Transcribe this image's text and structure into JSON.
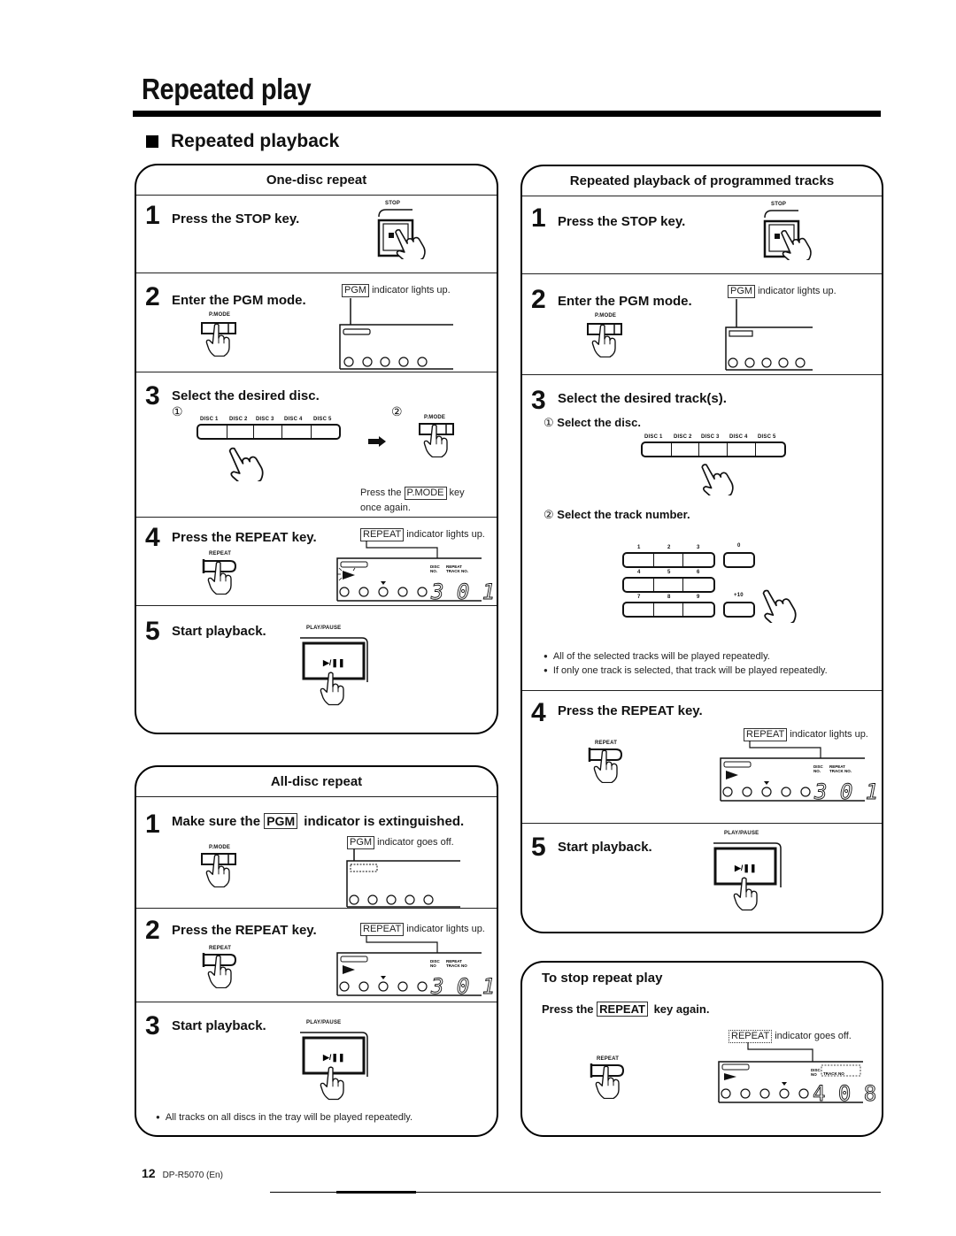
{
  "page": {
    "title": "Repeated play",
    "section": "Repeated playback",
    "footer": {
      "page_number": "12",
      "model": "DP-R5070 (En)"
    }
  },
  "one_disc": {
    "heading": "One-disc repeat",
    "steps": [
      {
        "num": "1",
        "text": "Press the STOP key.",
        "key_label": "STOP"
      },
      {
        "num": "2",
        "text": "Enter the PGM mode.",
        "key_label": "P.MODE",
        "indicator": "PGM",
        "indicator_note": "indicator lights up.",
        "disc_indicators": [
          "1",
          "2",
          "3",
          "4",
          "5"
        ]
      },
      {
        "num": "3",
        "text": "Select the desired disc.",
        "sub1": "①",
        "sub2": "②",
        "disc_buttons": [
          "DISC 1",
          "DISC 2",
          "DISC 3",
          "DISC 4",
          "DISC 5"
        ],
        "key_label": "P.MODE",
        "note_pre": "Press the",
        "note_key": "P.MODE",
        "note_post": "key",
        "note_line2": "once again."
      },
      {
        "num": "4",
        "text": "Press the REPEAT key.",
        "key_label": "REPEAT",
        "indicator": "REPEAT",
        "indicator_note": "indicator lights up.",
        "display": {
          "disc_label": "DISC NO.",
          "track_label": "REPEAT TRACK NO.",
          "digits": "3 0 1",
          "selected_disc": "3"
        }
      },
      {
        "num": "5",
        "text": "Start playback.",
        "key_label": "PLAY/PAUSE",
        "key_glyph": "▶/❚❚"
      }
    ]
  },
  "all_disc": {
    "heading": "All-disc repeat",
    "steps": [
      {
        "num": "1",
        "text_pre": "Make sure the",
        "text_key": "PGM",
        "text_post": "indicator is extinguished.",
        "key_label": "P.MODE",
        "indicator": "PGM",
        "indicator_note": "indicator goes off."
      },
      {
        "num": "2",
        "text": "Press the REPEAT key.",
        "key_label": "REPEAT",
        "indicator": "REPEAT",
        "indicator_note": "indicator lights up.",
        "display": {
          "disc_label": "DISC NO",
          "track_label": "REPEAT TRACK NO",
          "digits": "3 0 1"
        }
      },
      {
        "num": "3",
        "text": "Start playback.",
        "key_label": "PLAY/PAUSE",
        "key_glyph": "▶/❚❚",
        "bullet": "All tracks on all discs in the tray will be played repeatedly."
      }
    ]
  },
  "programmed": {
    "heading": "Repeated playback of programmed tracks",
    "steps": [
      {
        "num": "1",
        "text": "Press the STOP key.",
        "key_label": "STOP"
      },
      {
        "num": "2",
        "text": "Enter the PGM mode.",
        "key_label": "P.MODE",
        "indicator": "PGM",
        "indicator_note": "indicator lights up."
      },
      {
        "num": "3",
        "text": "Select the desired track(s).",
        "sub1_mark": "①",
        "sub1": "Select the disc.",
        "disc_buttons": [
          "DISC 1",
          "DISC 2",
          "DISC 3",
          "DISC 4",
          "DISC 5"
        ],
        "sub2_mark": "②",
        "sub2": "Select the track number.",
        "keypad": [
          "1",
          "2",
          "3",
          "0",
          "4",
          "5",
          "6",
          "7",
          "8",
          "9",
          "+10"
        ],
        "bullets": [
          "All of the selected tracks will be played repeatedly.",
          "If only one track is selected, that track will be played repeatedly."
        ]
      },
      {
        "num": "4",
        "text": "Press the REPEAT key.",
        "key_label": "REPEAT",
        "indicator": "REPEAT",
        "indicator_note": "indicator lights up.",
        "display": {
          "disc_label": "DISC NO.",
          "track_label": "REPEAT TRACK NO.",
          "digits": "3 0 1"
        }
      },
      {
        "num": "5",
        "text": "Start playback.",
        "key_label": "PLAY/PAUSE",
        "key_glyph": "▶/❚❚"
      }
    ]
  },
  "stop_repeat": {
    "heading": "To stop repeat play",
    "instruction_pre": "Press the",
    "instruction_key": "REPEAT",
    "instruction_post": "key again.",
    "key_label": "REPEAT",
    "indicator": "REPEAT",
    "indicator_note": "indicator goes off.",
    "display": {
      "disc_label": "DISC NO",
      "track_label": "REPEAT TRACK NO",
      "digits": "4 0 8",
      "selected_disc": "4"
    }
  }
}
